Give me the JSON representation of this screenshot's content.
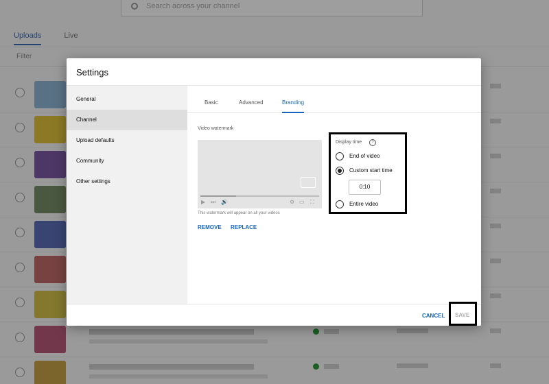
{
  "background": {
    "search_placeholder": "Search across your channel",
    "tabs": [
      "Uploads",
      "Live"
    ],
    "filter_label": "Filter",
    "row_thumb_colors": [
      "#8fb7d6",
      "#e3c43c",
      "#7d5aa6",
      "#7a8f6a",
      "#5d6fb8",
      "#c26b6b",
      "#d4c24a",
      "#b85a7a",
      "#c9a34a"
    ]
  },
  "dialog": {
    "title": "Settings",
    "sidebar": {
      "items": [
        {
          "label": "General"
        },
        {
          "label": "Channel",
          "active": true
        },
        {
          "label": "Upload defaults"
        },
        {
          "label": "Community"
        },
        {
          "label": "Other settings"
        }
      ]
    },
    "tabs": [
      {
        "label": "Basic"
      },
      {
        "label": "Advanced"
      },
      {
        "label": "Branding",
        "active": true
      }
    ],
    "watermark": {
      "label": "Video watermark",
      "note": "This watermark will appear on all your videos",
      "remove_label": "REMOVE",
      "replace_label": "REPLACE",
      "playback_progress": 0.3
    },
    "display_time": {
      "title": "Display time",
      "help_glyph": "?",
      "options": [
        {
          "label": "End of video",
          "selected": false
        },
        {
          "label": "Custom start time",
          "selected": true
        },
        {
          "label": "Entire video",
          "selected": false
        }
      ],
      "custom_time_value": "0:10"
    },
    "footer": {
      "cancel_label": "CANCEL",
      "save_label": "SAVE"
    }
  },
  "colors": {
    "accent": "#1565c0",
    "overlay": "rgba(0,0,0,0.38)",
    "live_dot": "#2b9a3a"
  }
}
